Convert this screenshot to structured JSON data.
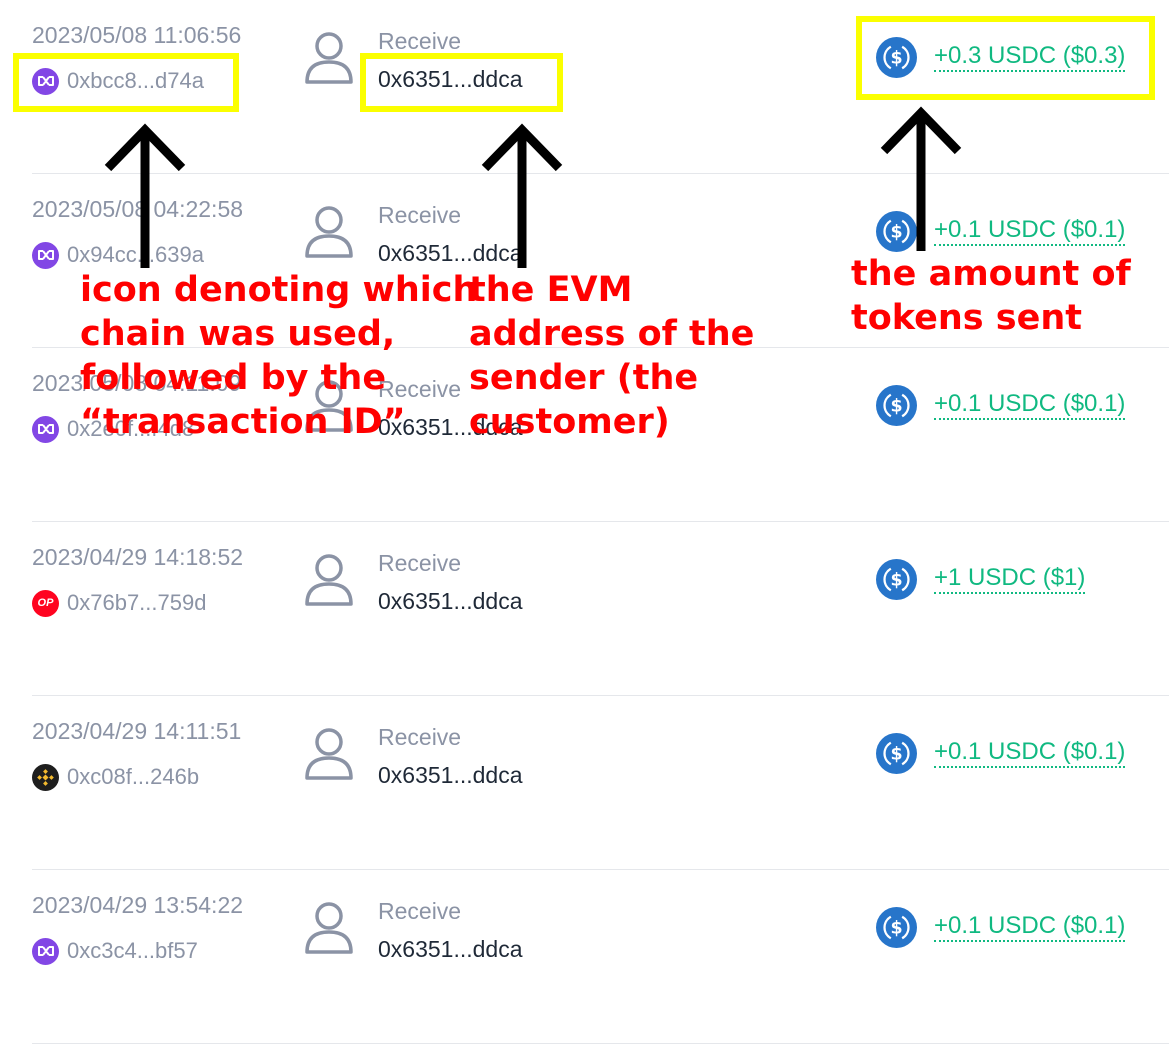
{
  "transactions": [
    {
      "timestamp": "2023/05/08 11:06:56",
      "chain_icon": "polygon-icon",
      "tx_id": "0xbcc8...d74a",
      "type": "Receive",
      "address": "0x6351...ddca",
      "amount": "+0.3 USDC ($0.3)"
    },
    {
      "timestamp": "2023/05/08 04:22:58",
      "chain_icon": "polygon-icon",
      "tx_id": "0x94cc...639a",
      "type": "Receive",
      "address": "0x6351...ddca",
      "amount": "+0.1 USDC ($0.1)"
    },
    {
      "timestamp": "2023/05/08 04:11:09",
      "chain_icon": "polygon-icon",
      "tx_id": "0x2e0f...f4d8",
      "type": "Receive",
      "address": "0x6351...ddca",
      "amount": "+0.1 USDC ($0.1)"
    },
    {
      "timestamp": "2023/04/29 14:18:52",
      "chain_icon": "optimism-icon",
      "tx_id": "0x76b7...759d",
      "type": "Receive",
      "address": "0x6351...ddca",
      "amount": "+1 USDC ($1)"
    },
    {
      "timestamp": "2023/04/29 14:11:51",
      "chain_icon": "bnb-chain-icon",
      "tx_id": "0xc08f...246b",
      "type": "Receive",
      "address": "0x6351...ddca",
      "amount": "+0.1 USDC ($0.1)"
    },
    {
      "timestamp": "2023/04/29 13:54:22",
      "chain_icon": "polygon-icon",
      "tx_id": "0xc3c4...bf57",
      "type": "Receive",
      "address": "0x6351...ddca",
      "amount": "+0.1 USDC ($0.1)"
    }
  ],
  "annotations": {
    "chain": "icon denoting which\nchain was used,\nfollowed by the\n“transaction ID”",
    "sender": "the EVM\naddress of the\nsender (the\ncustomer)",
    "amount": "the amount of\ntokens sent"
  },
  "colors": {
    "amount_green": "#10b981",
    "muted_text": "#8b93a5",
    "highlight_yellow": "#fbff00",
    "annotation_red": "#ff0000",
    "usdc_blue": "#2775ca",
    "polygon_purple": "#8247e5",
    "optimism_red": "#ff0420"
  }
}
